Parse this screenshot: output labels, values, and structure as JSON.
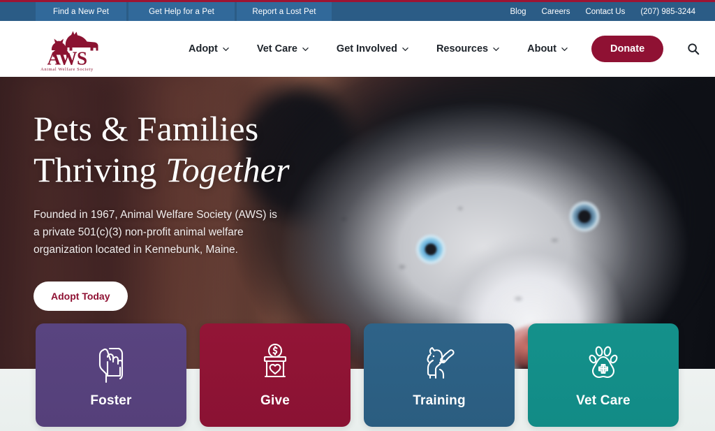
{
  "site": {
    "org_name": "AWS",
    "org_tagline": "Animal Welfare Society",
    "accent_crimson": "#8f1133",
    "utility_bar_bg": "#2b5c86",
    "utility_btn_bg": "#31699a"
  },
  "utility_bar": {
    "buttons": [
      {
        "label": "Find a New Pet"
      },
      {
        "label": "Get Help for a Pet"
      },
      {
        "label": "Report a Lost Pet"
      }
    ],
    "links": [
      {
        "label": "Blog"
      },
      {
        "label": "Careers"
      },
      {
        "label": "Contact Us"
      }
    ],
    "phone": "(207) 985-3244"
  },
  "header": {
    "logo_title": "AWS",
    "logo_subtitle": "Animal Welfare Society",
    "nav": [
      {
        "label": "Adopt",
        "has_dropdown": true
      },
      {
        "label": "Vet Care",
        "has_dropdown": true
      },
      {
        "label": "Get Involved",
        "has_dropdown": true
      },
      {
        "label": "Resources",
        "has_dropdown": true
      },
      {
        "label": "About",
        "has_dropdown": true
      }
    ],
    "donate_label": "Donate",
    "search_icon": "search-icon"
  },
  "hero": {
    "title_line1": "Pets & Families",
    "title_line2_normal": "Thriving ",
    "title_line2_italic": "Together",
    "paragraph": "Founded in 1967, Animal Welfare Society (AWS) is a private 501(c)(3) non-profit animal welfare organization located in Kennebunk, Maine.",
    "cta_label": "Adopt Today"
  },
  "cards": [
    {
      "label": "Foster",
      "color": "#594480",
      "color_end": "#55407a",
      "icon": "helping-hands-icon"
    },
    {
      "label": "Give",
      "color": "#931536",
      "color_end": "#8a1233",
      "icon": "donation-box-icon"
    },
    {
      "label": "Training",
      "color": "#2e6388",
      "color_end": "#2b5d80",
      "icon": "dog-training-icon"
    },
    {
      "label": "Vet Care",
      "color": "#14918b",
      "color_end": "#128b86",
      "icon": "paw-cross-icon"
    }
  ]
}
